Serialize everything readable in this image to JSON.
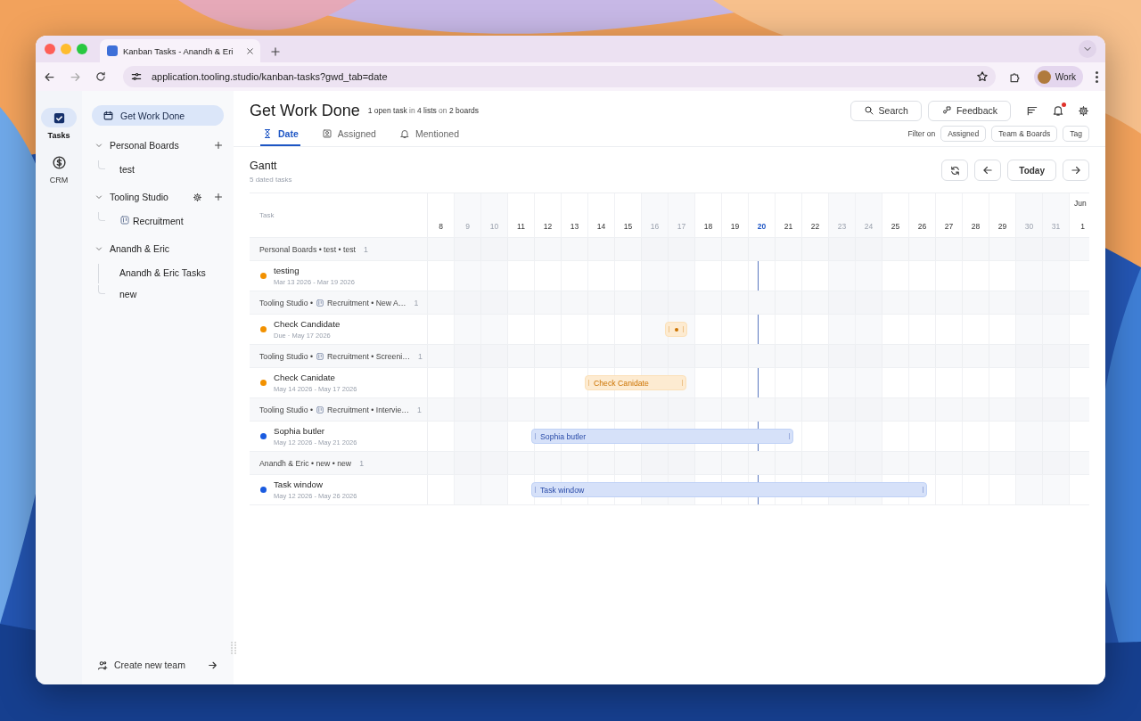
{
  "browser": {
    "tab_title": "Kanban Tasks - Anandh & Eri",
    "url": "application.tooling.studio/kanban-tasks?gwd_tab=date",
    "profile": "Work"
  },
  "rail": [
    {
      "label": "Tasks",
      "kind": "tasks",
      "selected": true
    },
    {
      "label": "CRM",
      "kind": "crm",
      "selected": false
    }
  ],
  "sidebar": {
    "home": {
      "label": "Get Work Done",
      "selected": true
    },
    "teams": [
      {
        "name": "Personal Boards",
        "expanded": true,
        "settings": false,
        "add": true,
        "children": [
          {
            "label": "test",
            "board_icon": false
          }
        ]
      },
      {
        "name": "Tooling Studio",
        "expanded": true,
        "settings": true,
        "add": true,
        "children": [
          {
            "label": "Recruitment",
            "board_icon": true
          }
        ]
      },
      {
        "name": "Anandh & Eric",
        "expanded": true,
        "settings": false,
        "add": false,
        "children": [
          {
            "label": "Anandh & Eric Tasks",
            "board_icon": false
          },
          {
            "label": "new",
            "board_icon": false
          }
        ]
      }
    ],
    "create_team": "Create new team"
  },
  "header": {
    "title": "Get Work Done",
    "summary": "**1 open task** in **4 lists** on **2 boards**",
    "tabs": [
      {
        "label": "Date",
        "kind": "date",
        "selected": true
      },
      {
        "label": "Assigned",
        "kind": "assigned",
        "selected": false
      },
      {
        "label": "Mentioned",
        "kind": "mentioned",
        "selected": false
      }
    ],
    "search": "Search",
    "feedback": "Feedback",
    "notifications_unread": true,
    "filter_label": "Filter on",
    "filters": [
      "Assigned",
      "Team & Boards",
      "Tag"
    ]
  },
  "gantt": {
    "title": "Gantt",
    "subtitle": "5 dated tasks",
    "today_button": "Today",
    "task_column": "Task",
    "days": [
      {
        "label": "8",
        "weekend": false,
        "today": false
      },
      {
        "label": "9",
        "weekend": true,
        "today": false
      },
      {
        "label": "10",
        "weekend": true,
        "today": false
      },
      {
        "label": "11",
        "weekend": false,
        "today": false
      },
      {
        "label": "12",
        "weekend": false,
        "today": false
      },
      {
        "label": "13",
        "weekend": false,
        "today": false
      },
      {
        "label": "14",
        "weekend": false,
        "today": false
      },
      {
        "label": "15",
        "weekend": false,
        "today": false
      },
      {
        "label": "16",
        "weekend": true,
        "today": false
      },
      {
        "label": "17",
        "weekend": true,
        "today": false
      },
      {
        "label": "18",
        "weekend": false,
        "today": false
      },
      {
        "label": "19",
        "weekend": false,
        "today": false
      },
      {
        "label": "20",
        "weekend": false,
        "today": true
      },
      {
        "label": "21",
        "weekend": false,
        "today": false
      },
      {
        "label": "22",
        "weekend": false,
        "today": false
      },
      {
        "label": "23",
        "weekend": true,
        "today": false
      },
      {
        "label": "24",
        "weekend": true,
        "today": false
      },
      {
        "label": "25",
        "weekend": false,
        "today": false
      },
      {
        "label": "26",
        "weekend": false,
        "today": false
      },
      {
        "label": "27",
        "weekend": false,
        "today": false
      },
      {
        "label": "28",
        "weekend": false,
        "today": false
      },
      {
        "label": "29",
        "weekend": false,
        "today": false
      },
      {
        "label": "30",
        "weekend": true,
        "today": false
      },
      {
        "label": "31",
        "weekend": true,
        "today": false
      },
      {
        "label": "1",
        "weekend": false,
        "today": false,
        "month": "Jun"
      }
    ],
    "groups": [
      {
        "prefix": "Personal Boards • test • test",
        "count": "1",
        "tasks": [
          {
            "title": "testing",
            "dates": "Mar 13 2026 - Mar 19 2026",
            "color": "#f29100"
          }
        ]
      },
      {
        "prefix": "Tooling Studio •",
        "board": "Recruitment • New A…",
        "count": "1",
        "tasks": [
          {
            "title": "Check Candidate",
            "dates": "Due · May 17 2026",
            "color": "#f29100",
            "bar": {
              "kind": "milestone"
            }
          }
        ]
      },
      {
        "prefix": "Tooling Studio •",
        "board": "Recruitment • Screeni…",
        "count": "1",
        "tasks": [
          {
            "title": "Check Canidate",
            "dates": "May 14 2026 - May 17 2026",
            "color": "#f29100",
            "bar": {
              "kind": "range",
              "label": "Check Canidate"
            }
          }
        ]
      },
      {
        "prefix": "Tooling Studio •",
        "board": "Recruitment • Intervie…",
        "count": "1",
        "tasks": [
          {
            "title": "Sophia butler",
            "dates": "May 12 2026 - May 21 2026",
            "color": "#1a5be0",
            "bar": {
              "kind": "range",
              "label": "Sophia butler"
            }
          }
        ]
      },
      {
        "prefix": "Anandh & Eric • new • new",
        "count": "1",
        "tasks": [
          {
            "title": "Task window",
            "dates": "May 12 2026 - May 26 2026",
            "color": "#1a5be0",
            "bar": {
              "kind": "range",
              "label": "Task window"
            }
          }
        ]
      }
    ]
  }
}
